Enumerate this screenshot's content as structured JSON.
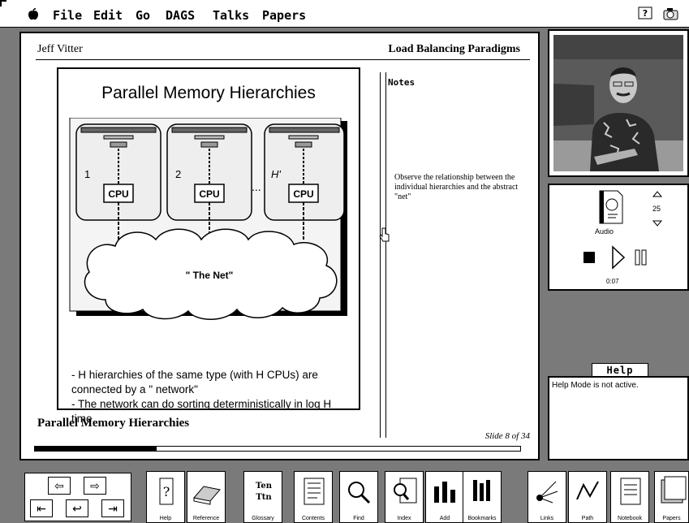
{
  "menubar": {
    "apple": "",
    "items": [
      "File",
      "Edit",
      "Go",
      "DAGS",
      "Talks",
      "Papers"
    ],
    "right_icons": [
      "help-icon",
      "camera-icon"
    ]
  },
  "header": {
    "speaker": "Jeff Vitter",
    "talk_title": "Load Balancing Paradigms"
  },
  "slide": {
    "title": "Parallel  Memory Hierarchies",
    "figure": {
      "labels": [
        "1",
        "2",
        "...",
        "H'"
      ],
      "cpu_label": "CPU",
      "net_label": "\" The Net\""
    },
    "caption": [
      "- H hierarchies of the same type (with H CPUs) are connected by a \" network\"",
      "- The network can do sorting deterministically in log H time."
    ],
    "footer_title": "Parallel Memory Hierarchies",
    "slide_number": "Slide 8 of 34",
    "progress": 0.25
  },
  "notes": {
    "label": "Notes",
    "text": "Observe the relationship between the individual hierarchies and the abstract \"net\""
  },
  "audio": {
    "doc_label": "Audio",
    "volume": "25",
    "time": "0:07"
  },
  "help": {
    "button_label": "Help",
    "text": "Help Mode is not active."
  },
  "toolbar": {
    "tools": [
      "Help",
      "Reference",
      "Glossary",
      "Contents",
      "Find",
      "Index",
      "Add",
      "Bookmarks",
      "Links",
      "Path",
      "Notebook",
      "Papers"
    ]
  },
  "colors": {
    "background": "#7a7a7a",
    "panel": "#ffffff",
    "ink": "#000000"
  }
}
